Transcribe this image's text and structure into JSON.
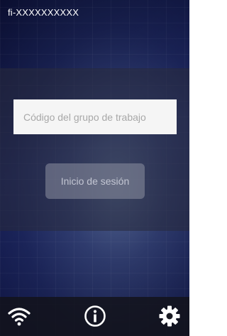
{
  "header": {
    "device_id": "fi-XXXXXXXXXX"
  },
  "login": {
    "group_code_placeholder": "Código del grupo de trabajo",
    "group_code_value": "",
    "login_button_label": "Inicio de sesión"
  },
  "bottom_bar": {
    "icons": [
      "wifi-icon",
      "info-icon",
      "settings-icon"
    ]
  },
  "colors": {
    "background_dark": "#10164a",
    "background_light": "#5a6e9c",
    "text": "#ffffff",
    "input_bg": "#f5f5f5",
    "placeholder": "#a8a8a8",
    "bottom_bar": "#121218"
  }
}
